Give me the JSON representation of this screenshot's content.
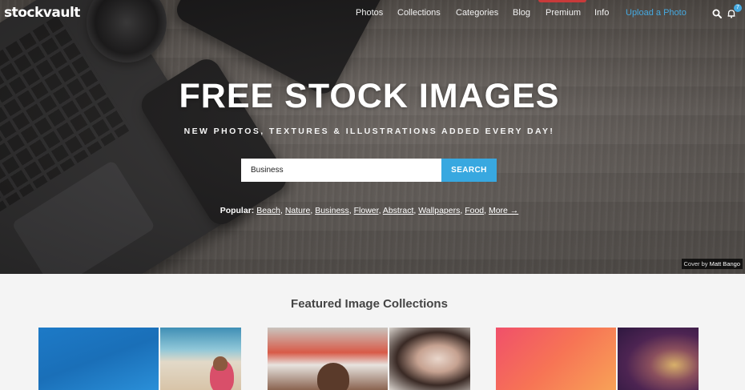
{
  "logo": {
    "text": "stockvault"
  },
  "nav": {
    "items": [
      {
        "label": "Photos"
      },
      {
        "label": "Collections"
      },
      {
        "label": "Categories"
      },
      {
        "label": "Blog"
      },
      {
        "label": "Premium"
      },
      {
        "label": "Info"
      },
      {
        "label": "Upload a Photo"
      }
    ],
    "notifications_count": "7"
  },
  "hero": {
    "title": "FREE STOCK IMAGES",
    "subtitle": "NEW PHOTOS, TEXTURES & ILLUSTRATIONS ADDED EVERY DAY!",
    "search": {
      "value": "Business",
      "button_label": "SEARCH"
    },
    "popular": {
      "label": "Popular:",
      "links": [
        "Beach",
        "Nature",
        "Business",
        "Flower",
        "Abstract",
        "Wallpapers",
        "Food",
        "More →"
      ]
    },
    "credit": {
      "prefix": "Cover",
      "by": "by",
      "author": "Matt Bango"
    }
  },
  "featured": {
    "title": "Featured Image Collections"
  },
  "colors": {
    "accent": "#38a8e0",
    "upload_link": "#45a9e0",
    "premium_mark": "#c83a3a"
  }
}
